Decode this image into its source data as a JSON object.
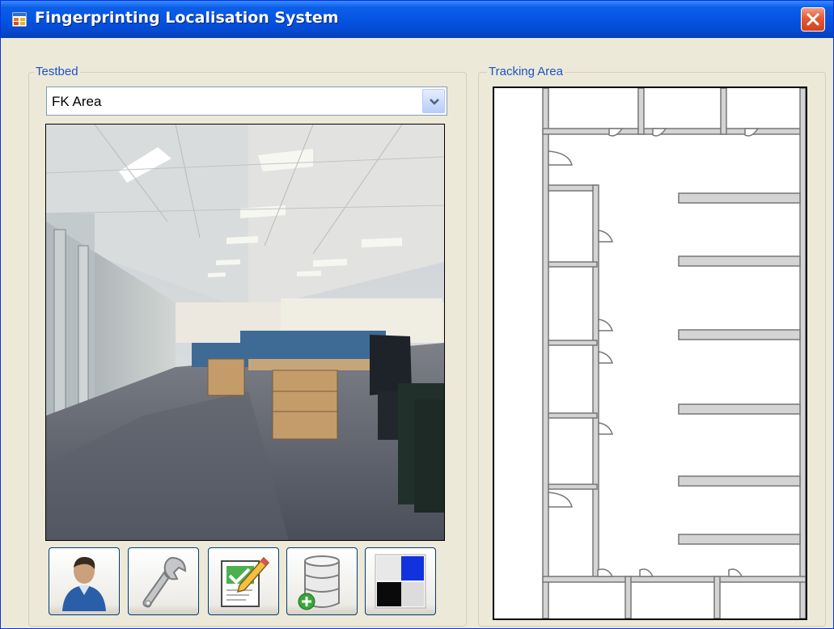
{
  "window": {
    "title": "Fingerprinting Localisation System"
  },
  "testbed": {
    "group_label": "Testbed",
    "selected_area": "FK Area"
  },
  "tracking": {
    "group_label": "Tracking Area"
  },
  "toolbar": {
    "buttons": [
      {
        "icon": "user-icon"
      },
      {
        "icon": "wrench-icon"
      },
      {
        "icon": "edit-document-icon"
      },
      {
        "icon": "database-add-icon"
      },
      {
        "icon": "checker-pattern-icon"
      }
    ]
  },
  "colors": {
    "titlebar": "#0554e3",
    "window_bg": "#ece9d8",
    "group_label": "#1b52c8",
    "close_button": "#e35a35"
  }
}
